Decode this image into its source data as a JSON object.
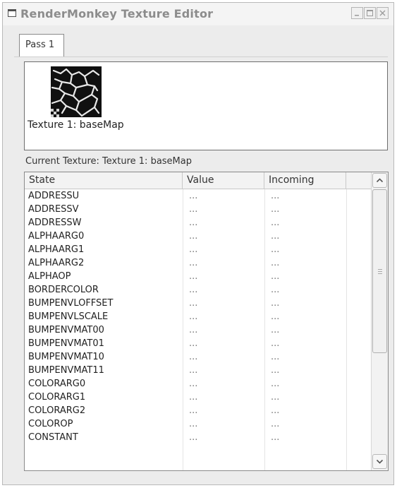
{
  "window": {
    "title": "RenderMonkey Texture Editor"
  },
  "tabs": [
    {
      "label": "Pass 1"
    }
  ],
  "preview": {
    "texture_label": "Texture 1: baseMap"
  },
  "current_texture_label": "Current Texture: Texture 1: baseMap",
  "grid": {
    "columns": [
      "State",
      "Value",
      "Incoming"
    ],
    "rows": [
      {
        "state": "ADDRESSU",
        "value": "...",
        "incoming": "..."
      },
      {
        "state": "ADDRESSV",
        "value": "...",
        "incoming": "..."
      },
      {
        "state": "ADDRESSW",
        "value": "...",
        "incoming": "..."
      },
      {
        "state": "ALPHAARG0",
        "value": "...",
        "incoming": "..."
      },
      {
        "state": "ALPHAARG1",
        "value": "...",
        "incoming": "..."
      },
      {
        "state": "ALPHAARG2",
        "value": "...",
        "incoming": "..."
      },
      {
        "state": "ALPHAOP",
        "value": "...",
        "incoming": "..."
      },
      {
        "state": "BORDERCOLOR",
        "value": "...",
        "incoming": "..."
      },
      {
        "state": "BUMPENVLOFFSET",
        "value": "...",
        "incoming": "..."
      },
      {
        "state": "BUMPENVLSCALE",
        "value": "...",
        "incoming": "..."
      },
      {
        "state": "BUMPENVMAT00",
        "value": "...",
        "incoming": "..."
      },
      {
        "state": "BUMPENVMAT01",
        "value": "...",
        "incoming": "..."
      },
      {
        "state": "BUMPENVMAT10",
        "value": "...",
        "incoming": "..."
      },
      {
        "state": "BUMPENVMAT11",
        "value": "...",
        "incoming": "..."
      },
      {
        "state": "COLORARG0",
        "value": "...",
        "incoming": "..."
      },
      {
        "state": "COLORARG1",
        "value": "...",
        "incoming": "..."
      },
      {
        "state": "COLORARG2",
        "value": "...",
        "incoming": "..."
      },
      {
        "state": "COLOROP",
        "value": "...",
        "incoming": "..."
      },
      {
        "state": "CONSTANT",
        "value": "...",
        "incoming": "..."
      }
    ]
  },
  "icons": {
    "window_icon": "window-icon",
    "minimize": "minimize-icon",
    "maximize": "maximize-icon",
    "close": "close-icon",
    "scroll_up": "chevron-up-icon",
    "scroll_down": "chevron-down-icon"
  }
}
